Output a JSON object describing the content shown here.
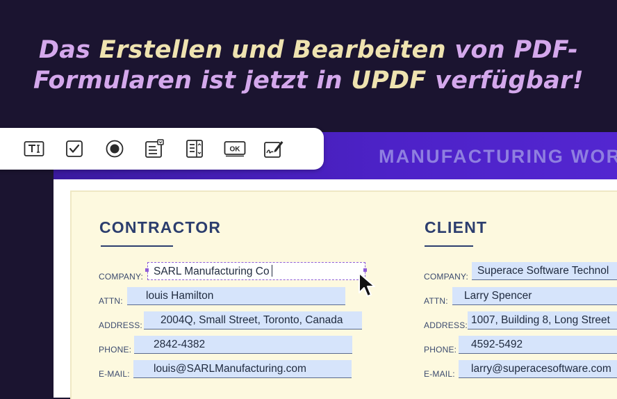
{
  "headline": {
    "part1": "Das ",
    "part2": "Erstellen und Bearbeiten",
    "part3": " von PDF-",
    "part4": "Formularen",
    "part5": " ist jetzt in ",
    "part6": "UPDF",
    "part7": " verfügbar!"
  },
  "colors": {
    "background": "#1b1430",
    "headline_lilac": "#d4a8ec",
    "headline_cream": "#efe3b0",
    "banner": "#4d22c8",
    "field_bg": "#d6e4fb",
    "panel_bg": "#fdf9df",
    "title_navy": "#2c3e6e"
  },
  "toolbar": {
    "tools": [
      {
        "icon": "text-field-icon"
      },
      {
        "icon": "checkbox-icon"
      },
      {
        "icon": "radio-button-icon"
      },
      {
        "icon": "dropdown-icon"
      },
      {
        "icon": "list-box-icon"
      },
      {
        "icon": "button-icon",
        "label": "OK"
      },
      {
        "icon": "signature-icon"
      }
    ]
  },
  "document": {
    "banner_title": "MANUFACTURING WOR",
    "contractor": {
      "title": "CONTRACTOR",
      "fields": [
        {
          "label": "COMPANY:",
          "value": "SARL Manufacturing Co"
        },
        {
          "label": "ATTN:",
          "value": "louis Hamilton"
        },
        {
          "label": "ADDRESS:",
          "value": "2004Q, Small Street, Toronto, Canada"
        },
        {
          "label": "PHONE:",
          "value": "2842-4382"
        },
        {
          "label": "E-MAIL:",
          "value": "louis@SARLManufacturing.com"
        }
      ]
    },
    "client": {
      "title": "CLIENT",
      "fields": [
        {
          "label": "COMPANY:",
          "value": "Superace Software Technol"
        },
        {
          "label": "ATTN:",
          "value": "Larry Spencer"
        },
        {
          "label": "ADDRESS:",
          "value": "1007, Building 8, Long Street"
        },
        {
          "label": "PHONE:",
          "value": "4592-5492"
        },
        {
          "label": "E-MAIL:",
          "value": "larry@superacesoftware.com"
        }
      ]
    }
  }
}
